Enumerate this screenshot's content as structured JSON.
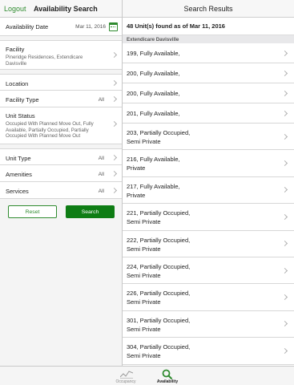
{
  "left": {
    "logout": "Logout",
    "title": "Availability Search",
    "availability_date": {
      "label": "Availability Date",
      "value": "Mar 11, 2016",
      "icon": "calendar-icon"
    },
    "facility": {
      "label": "Facility",
      "value": "Pineridge Residences, Extendicare Davisville"
    },
    "location": {
      "label": "Location"
    },
    "facility_type": {
      "label": "Facility Type",
      "value": "All"
    },
    "unit_status": {
      "label": "Unit Status",
      "value": "Occupied With Planned Move Out, Fully Available, Partially Occupied, Partially Occupied With Planned Move Out"
    },
    "unit_type": {
      "label": "Unit Type",
      "value": "All"
    },
    "amenities": {
      "label": "Amenities",
      "value": "All"
    },
    "services": {
      "label": "Services",
      "value": "All"
    },
    "reset_label": "Reset",
    "search_label": "Search"
  },
  "right": {
    "title": "Search Results",
    "found": "48 Unit(s) found as of Mar 11, 2016",
    "section": "Extendicare Davisville",
    "results": [
      {
        "line1": "199, Fully Available,",
        "line2": ""
      },
      {
        "line1": "200, Fully Available,",
        "line2": ""
      },
      {
        "line1": "200, Fully Available,",
        "line2": ""
      },
      {
        "line1": "201, Fully Available,",
        "line2": ""
      },
      {
        "line1": "203, Partially Occupied,",
        "line2": "Semi Private"
      },
      {
        "line1": "216, Fully Available,",
        "line2": "Private"
      },
      {
        "line1": "217, Fully Available,",
        "line2": "Private"
      },
      {
        "line1": "221, Partially Occupied,",
        "line2": "Semi Private"
      },
      {
        "line1": "222, Partially Occupied,",
        "line2": "Semi Private"
      },
      {
        "line1": "224, Partially Occupied,",
        "line2": "Semi Private"
      },
      {
        "line1": "226, Partially Occupied,",
        "line2": "Semi Private"
      },
      {
        "line1": "301, Partially Occupied,",
        "line2": "Semi Private"
      },
      {
        "line1": "304, Partially Occupied,",
        "line2": "Semi Private"
      }
    ]
  },
  "tabbar": {
    "tabs": [
      {
        "label": "Occupancy",
        "icon": "line-chart-icon"
      },
      {
        "label": "Availability",
        "icon": "search-icon"
      }
    ]
  },
  "colors": {
    "accent": "#2f8b2f",
    "button_green": "#0e7d14"
  }
}
